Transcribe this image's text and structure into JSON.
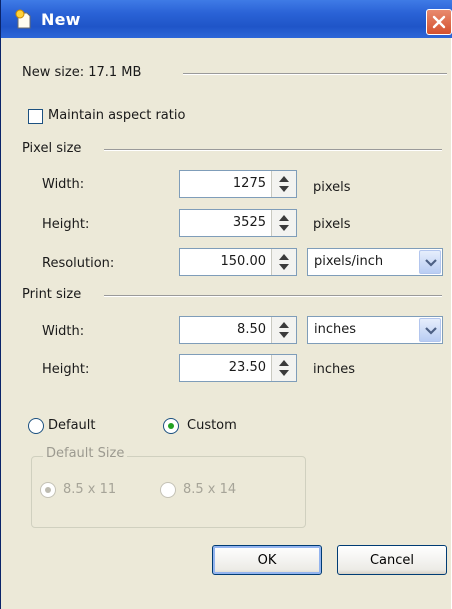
{
  "window": {
    "title": "New"
  },
  "summary": {
    "new_size": "New size: 17.1 MB"
  },
  "options": {
    "maintain_aspect_ratio": "Maintain aspect ratio",
    "maintain_checked": false
  },
  "pixel_size": {
    "heading": "Pixel size",
    "width_label": "Width:",
    "width_value": "1275",
    "width_unit": "pixels",
    "height_label": "Height:",
    "height_value": "3525",
    "height_unit": "pixels",
    "resolution_label": "Resolution:",
    "resolution_value": "150.00",
    "resolution_unit": "pixels/inch"
  },
  "print_size": {
    "heading": "Print size",
    "width_label": "Width:",
    "width_value": "8.50",
    "width_unit": "inches",
    "height_label": "Height:",
    "height_value": "23.50",
    "height_unit": "inches"
  },
  "mode": {
    "default_label": "Default",
    "custom_label": "Custom",
    "selected": "Custom"
  },
  "default_size": {
    "legend": "Default Size",
    "option_1": "8.5 x 11",
    "option_2": "8.5 x 14",
    "selected": "8.5 x 11",
    "enabled": false
  },
  "buttons": {
    "ok": "OK",
    "cancel": "Cancel"
  },
  "colors": {
    "title_bar": "#2a62d6",
    "dialog_bg": "#ece9d8",
    "close": "#d4512f",
    "radio_dot": "#21a121"
  },
  "icons": {
    "app": "new-document-icon",
    "close": "close-icon",
    "spin": "spin-arrows-icon",
    "dropdown": "chevron-down-icon"
  }
}
